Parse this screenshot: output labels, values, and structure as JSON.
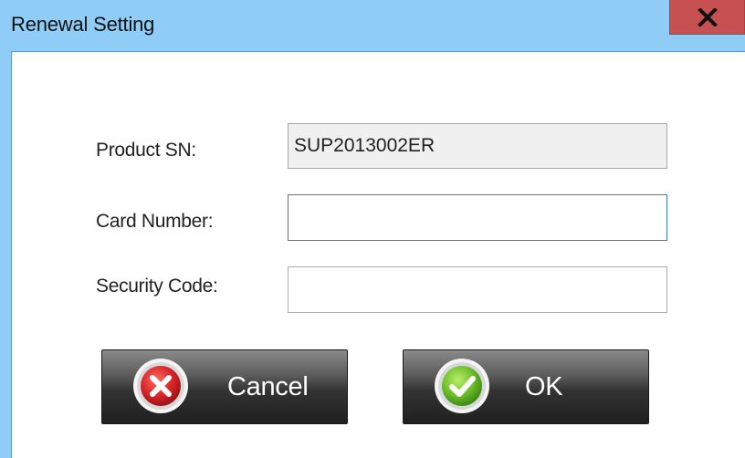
{
  "window": {
    "title": "Renewal Setting",
    "close_label": "X"
  },
  "form": {
    "product_sn_label": "Product SN:",
    "product_sn_value": "SUP2013002ER",
    "card_number_label": "Card Number:",
    "card_number_value": "",
    "security_code_label": "Security Code:",
    "security_code_value": ""
  },
  "buttons": {
    "cancel_label": "Cancel",
    "ok_label": "OK"
  },
  "icons": {
    "close": "close-x-icon",
    "cancel": "red-x-circle-icon",
    "ok": "green-check-circle-icon"
  },
  "colors": {
    "titlebar": "#8fcdf7",
    "close_button": "#c75050",
    "cancel_icon": "#d9252a",
    "ok_icon": "#6cbf2a"
  }
}
